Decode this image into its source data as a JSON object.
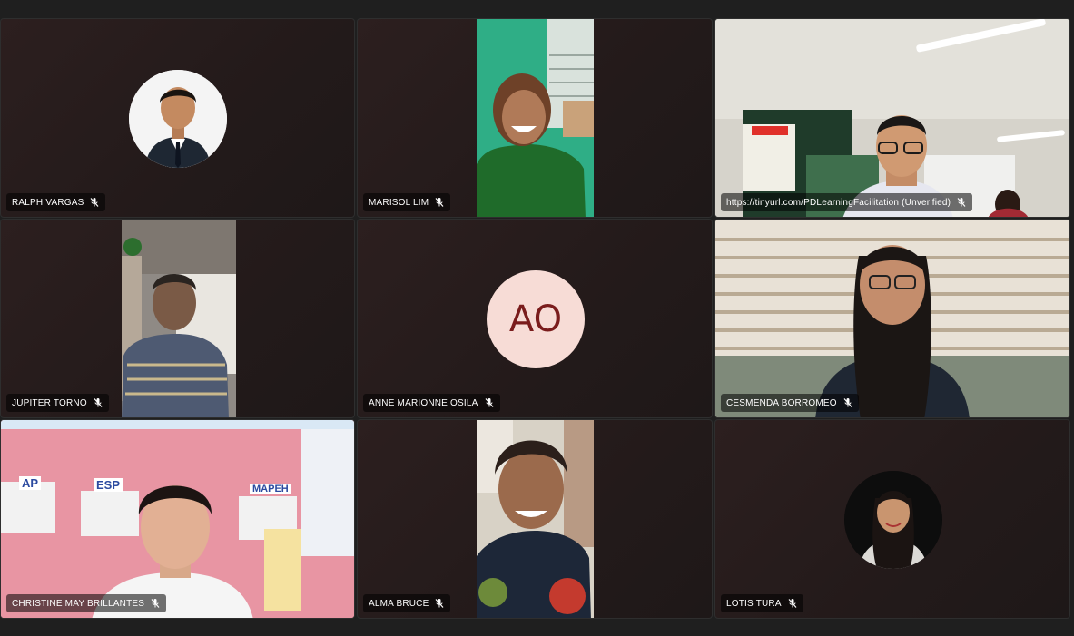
{
  "participants": [
    {
      "name": "RALPH VARGAS",
      "muted": true,
      "type": "photo-avatar"
    },
    {
      "name": "MARISOL LIM",
      "muted": true,
      "type": "video"
    },
    {
      "name": "https://tinyurl.com/PDLearningFacilitation (Unverified)",
      "muted": true,
      "type": "video"
    },
    {
      "name": "JUPITER TORNO",
      "muted": true,
      "type": "video"
    },
    {
      "name": "ANNE MARIONNE OSILA",
      "muted": true,
      "type": "initials",
      "initials": "AO"
    },
    {
      "name": "CESMENDA BORROMEO",
      "muted": true,
      "type": "video"
    },
    {
      "name": "CHRISTINE MAY BRILLANTES",
      "muted": true,
      "type": "video"
    },
    {
      "name": "ALMA BRUCE",
      "muted": true,
      "type": "video"
    },
    {
      "name": "LOTIS TURA",
      "muted": true,
      "type": "photo-avatar"
    }
  ],
  "colors": {
    "background": "#1f1f1f",
    "tile": "#241c1c",
    "initials_bg": "#f7dcd6",
    "initials_fg": "#7a1c1c"
  },
  "icons": {
    "mute": "mic-off-icon"
  },
  "video_texts": {
    "wall_labels": [
      "AP",
      "ESP",
      "MAPEH"
    ]
  }
}
